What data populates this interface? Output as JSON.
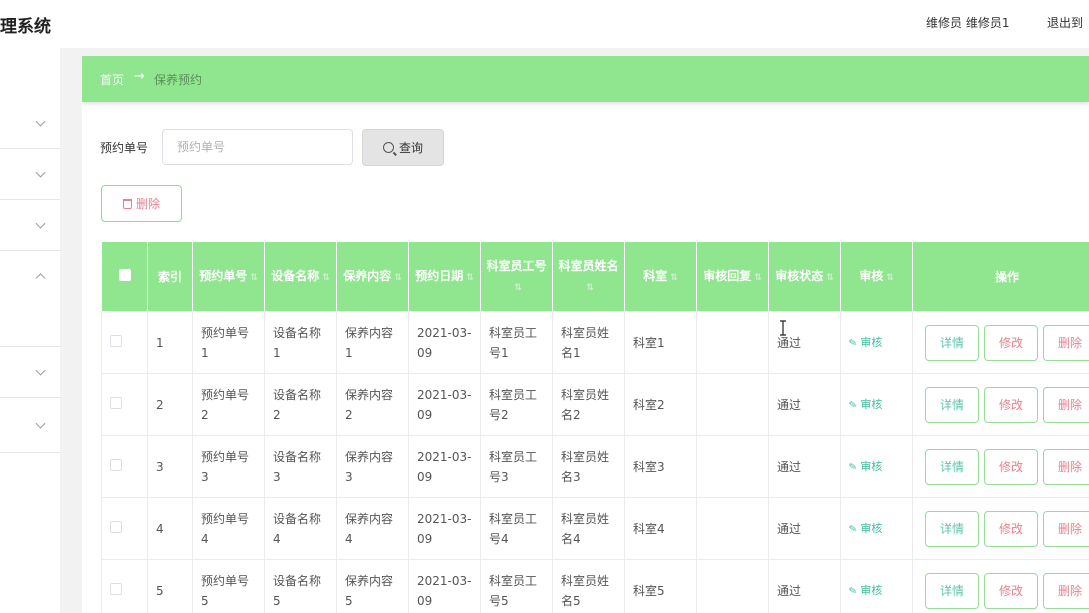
{
  "header": {
    "title": "理系统",
    "user": "维修员 维修员1",
    "logout": "退出到"
  },
  "breadcrumb": {
    "home": "首页",
    "arrow": "→",
    "current": "保养预约"
  },
  "search": {
    "label": "预约单号",
    "placeholder": "预约单号",
    "button": "查询"
  },
  "toolbar": {
    "delete_label": "删除"
  },
  "table": {
    "columns": [
      "索引",
      "预约单号",
      "设备名称",
      "保养内容",
      "预约日期",
      "科室员工号",
      "科室员姓名",
      "科室",
      "审核回复",
      "审核状态",
      "审核",
      "操作"
    ],
    "rows": [
      {
        "index": "1",
        "order_no": "预约单号1",
        "device": "设备名称1",
        "content": "保养内容1",
        "date": "2021-03-09",
        "staff_no": "科室员工号1",
        "staff_name": "科室员姓名1",
        "dept": "科室1",
        "reply": "",
        "status": "通过",
        "audit": "审核"
      },
      {
        "index": "2",
        "order_no": "预约单号2",
        "device": "设备名称2",
        "content": "保养内容2",
        "date": "2021-03-09",
        "staff_no": "科室员工号2",
        "staff_name": "科室员姓名2",
        "dept": "科室2",
        "reply": "",
        "status": "通过",
        "audit": "审核"
      },
      {
        "index": "3",
        "order_no": "预约单号3",
        "device": "设备名称3",
        "content": "保养内容3",
        "date": "2021-03-09",
        "staff_no": "科室员工号3",
        "staff_name": "科室员姓名3",
        "dept": "科室3",
        "reply": "",
        "status": "通过",
        "audit": "审核"
      },
      {
        "index": "4",
        "order_no": "预约单号4",
        "device": "设备名称4",
        "content": "保养内容4",
        "date": "2021-03-09",
        "staff_no": "科室员工号4",
        "staff_name": "科室员姓名4",
        "dept": "科室4",
        "reply": "",
        "status": "通过",
        "audit": "审核"
      },
      {
        "index": "5",
        "order_no": "预约单号5",
        "device": "设备名称5",
        "content": "保养内容5",
        "date": "2021-03-09",
        "staff_no": "科室员工号5",
        "staff_name": "科室员姓名5",
        "dept": "科室5",
        "reply": "",
        "status": "通过",
        "audit": "审核"
      }
    ],
    "actions": {
      "detail": "详情",
      "edit": "修改",
      "delete": "删除"
    }
  },
  "colors": {
    "accent": "#90e68f",
    "danger": "#e6828f",
    "link": "#3fbfa0"
  }
}
